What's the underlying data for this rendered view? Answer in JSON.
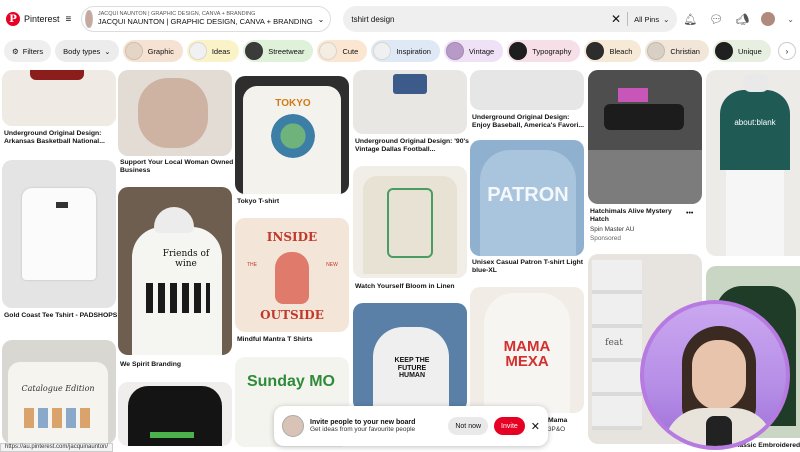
{
  "header": {
    "logo_text": "Pinterest",
    "board_sub": "JACQUI NAUNTON | GRAPHIC DESIGN, CANVA + BRANDING",
    "board_title": "JACQUI NAUNTON | GRAPHIC DESIGN, CANVA + BRANDING",
    "search_value": "tshirt design",
    "scope": "All Pins"
  },
  "filters": {
    "filters_label": "Filters",
    "body_types_label": "Body types",
    "chips": [
      "Graphic",
      "Ideas",
      "Streetwear",
      "Cute",
      "Inspiration",
      "Vintage",
      "Typography",
      "Bleach",
      "Christian",
      "Unique"
    ],
    "chip_colors": [
      "#f6e2d3",
      "#fbf3c8",
      "#dff1d8",
      "#fbe6d2",
      "#dfe9f6",
      "#efe1f6",
      "#f6dfe6",
      "#f6e9d6",
      "#f1e6d8",
      "#e6efe0"
    ]
  },
  "pins": {
    "p1": {
      "title": "Underground Original Design: Arkansas Basketball National..."
    },
    "p2": {
      "title": "Gold Coast Tee Tshirt - PADSHOPS"
    },
    "p3": {
      "title": "Support Your Local Woman Owned Business"
    },
    "p4": {
      "title": "We Spirit Branding"
    },
    "p5": {
      "title": "Tokyo T-shirt",
      "shirt_text_top": "TOKYO"
    },
    "p6": {
      "title": "Mindful Mantra T Shirts",
      "art_top": "INSIDE",
      "art_left": "THE",
      "art_right": "NEW",
      "art_bottom": "OUTSIDE"
    },
    "p7": {
      "title": "Underground Original Design: '90's Vintage Dallas Football..."
    },
    "p8": {
      "title": "Watch Yourself Bloom in Linen"
    },
    "p9": {
      "title": "Underground Original Design: Enjoy Baseball, America's Favori..."
    },
    "p10": {
      "title": "Unisex Casual Patron T-shirt Light blue-XL",
      "shirt_text": "PATRON"
    },
    "p11": {
      "title": "Hatchimals Alive Mystery Hatch",
      "sub": "Spin Master AU",
      "sub2": "Sponsored",
      "more": "•••"
    },
    "p12": {
      "shirt_text": "about:blank"
    },
    "p13": {
      "title": "Keep It Classic Embroidered"
    },
    "p14": {
      "shirt_text": "KEEP THE FUTURE HUMAN"
    },
    "p15": {
      "shirt_text": "MAMA MEXA",
      "title_partial": "Mama",
      "sub_partial": "3P&O"
    },
    "p16": {
      "shirt_text": "Sunday MO"
    },
    "p17": {
      "shirt_text": "Catalogue Edition"
    },
    "p18": {
      "shirt_text": "Friends of wine"
    },
    "p19": {
      "brand_text": "feat"
    }
  },
  "toast": {
    "title": "Invite people to your new board",
    "subtitle": "Get ideas from your favourite people",
    "not_now": "Not now",
    "invite": "Invite"
  },
  "status_url": "https://au.pinterest.com/jacquinaunton/"
}
